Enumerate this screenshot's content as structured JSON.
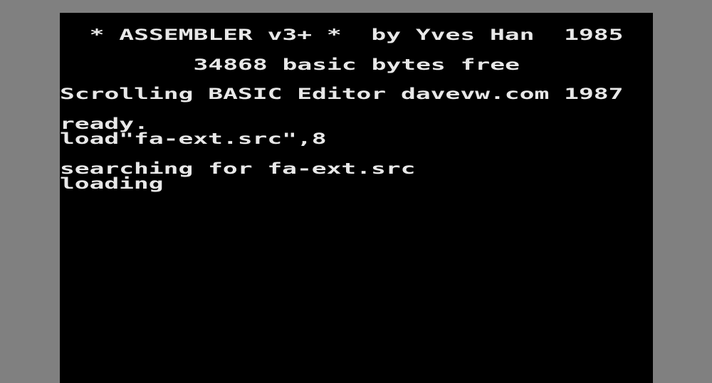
{
  "colors": {
    "border": "#808080",
    "screen_background": "#000000",
    "text": "#e8e8e8"
  },
  "screen": {
    "lines": [
      "  * ASSEMBLER v3+ *  by Yves Han  1985",
      "         34868 basic bytes free",
      "Scrolling BASIC Editor davevw.com 1987",
      "ready.",
      "load\"fa-ext.src\",8",
      "searching for fa-ext.src",
      "loading"
    ]
  }
}
